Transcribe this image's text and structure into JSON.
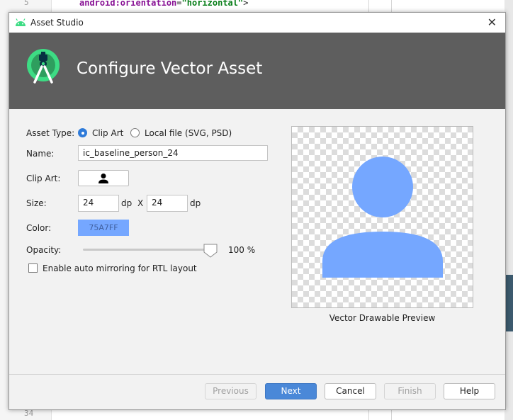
{
  "background": {
    "line_numbers": [
      "5",
      "34"
    ],
    "code_line": {
      "ns": "android",
      "attr": ":orientation",
      "eq": "=",
      "value": "\"horizontal\"",
      "end": ">"
    }
  },
  "dialog": {
    "window_title": "Asset Studio",
    "close_glyph": "✕",
    "heading": "Configure Vector Asset",
    "asset_type": {
      "label": "Asset Type:",
      "options": [
        {
          "label": "Clip Art",
          "selected": true
        },
        {
          "label": "Local file (SVG, PSD)",
          "selected": false
        }
      ]
    },
    "name": {
      "label": "Name:",
      "value": "ic_baseline_person_24"
    },
    "clip_art": {
      "label": "Clip Art:",
      "icon": "person-icon"
    },
    "size": {
      "label": "Size:",
      "width": "24",
      "height": "24",
      "unit": "dp",
      "separator": "X"
    },
    "color": {
      "label": "Color:",
      "value": "75A7FF",
      "hex": "#75A7FF"
    },
    "opacity": {
      "label": "Opacity:",
      "value": 100,
      "display": "100 %"
    },
    "auto_mirror": {
      "label": "Enable auto mirroring for RTL layout",
      "checked": false
    },
    "preview": {
      "caption": "Vector Drawable Preview",
      "icon": "person-icon",
      "color": "#75A7FF"
    },
    "buttons": {
      "previous": "Previous",
      "next": "Next",
      "cancel": "Cancel",
      "finish": "Finish",
      "help": "Help"
    }
  }
}
